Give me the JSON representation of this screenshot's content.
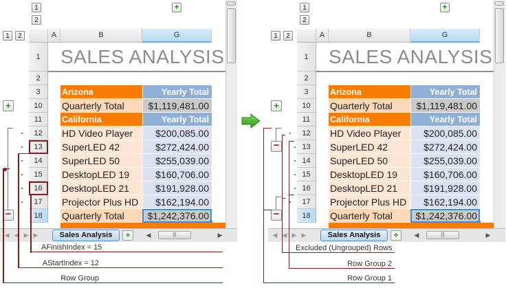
{
  "columns": {
    "a": "A",
    "b": "B",
    "g": "G"
  },
  "level_buttons": {
    "one": "1",
    "two": "2"
  },
  "title": "SALES ANALYSIS",
  "rows": [
    {
      "num": "1",
      "kind": "title"
    },
    {
      "num": "2",
      "kind": "blank"
    },
    {
      "num": "3",
      "kind": "state",
      "b": "Arizona",
      "g": "Yearly Total"
    },
    {
      "num": "10",
      "kind": "total",
      "b": "Quarterly Total",
      "g": "$1,119,481.00"
    },
    {
      "num": "11",
      "kind": "state",
      "b": "California",
      "g": "Yearly Total"
    },
    {
      "num": "12",
      "kind": "item",
      "b": "HD Video Player",
      "g": "$200,085.00"
    },
    {
      "num": "13",
      "kind": "item",
      "b": "SuperLED 42",
      "g": "$272,424.00"
    },
    {
      "num": "14",
      "kind": "item",
      "b": "SuperLED 50",
      "g": "$255,039.00"
    },
    {
      "num": "15",
      "kind": "item",
      "b": "DesktopLED 19",
      "g": "$160,706.00"
    },
    {
      "num": "16",
      "kind": "item",
      "b": "DesktopLED 21",
      "g": "$191,928.00"
    },
    {
      "num": "17",
      "kind": "item",
      "b": "Projector Plus HD",
      "g": "$162,194.00"
    },
    {
      "num": "18",
      "kind": "total",
      "b": "Quarterly Total",
      "g": "$1,242,376.00"
    }
  ],
  "sheet_tab": "Sales Analysis",
  "group_buttons": {
    "plus": "+",
    "minus": "−"
  },
  "hscroll_thumb": "|||",
  "annotations_left": {
    "finish": "AFinishIndex = 15",
    "start": "AStartIndex = 12",
    "group": "Row Group"
  },
  "annotations_right": {
    "excluded": "Excluded (Ungrouped) Rows",
    "group2": "Row Group 2",
    "group1": "Row Group 1"
  },
  "colors": {
    "state_header": "#f77c00",
    "yearly_header": "#8fafd6",
    "accent_red": "#8b1a1a",
    "arrow_green": "#3daa2e"
  }
}
